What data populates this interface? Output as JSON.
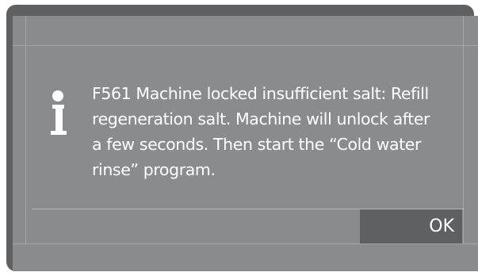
{
  "dialog": {
    "icon": "info-icon",
    "message": "F561 Machine locked insufficient salt: Refill regeneration salt. Machine will unlock after a few seconds. Then start the “Cold water rinse” program.",
    "ok_label": "OK"
  },
  "colors": {
    "bezel": "#5f6062",
    "screen": "#8a8b8d",
    "text": "#ffffff",
    "button": "#5f6062"
  }
}
